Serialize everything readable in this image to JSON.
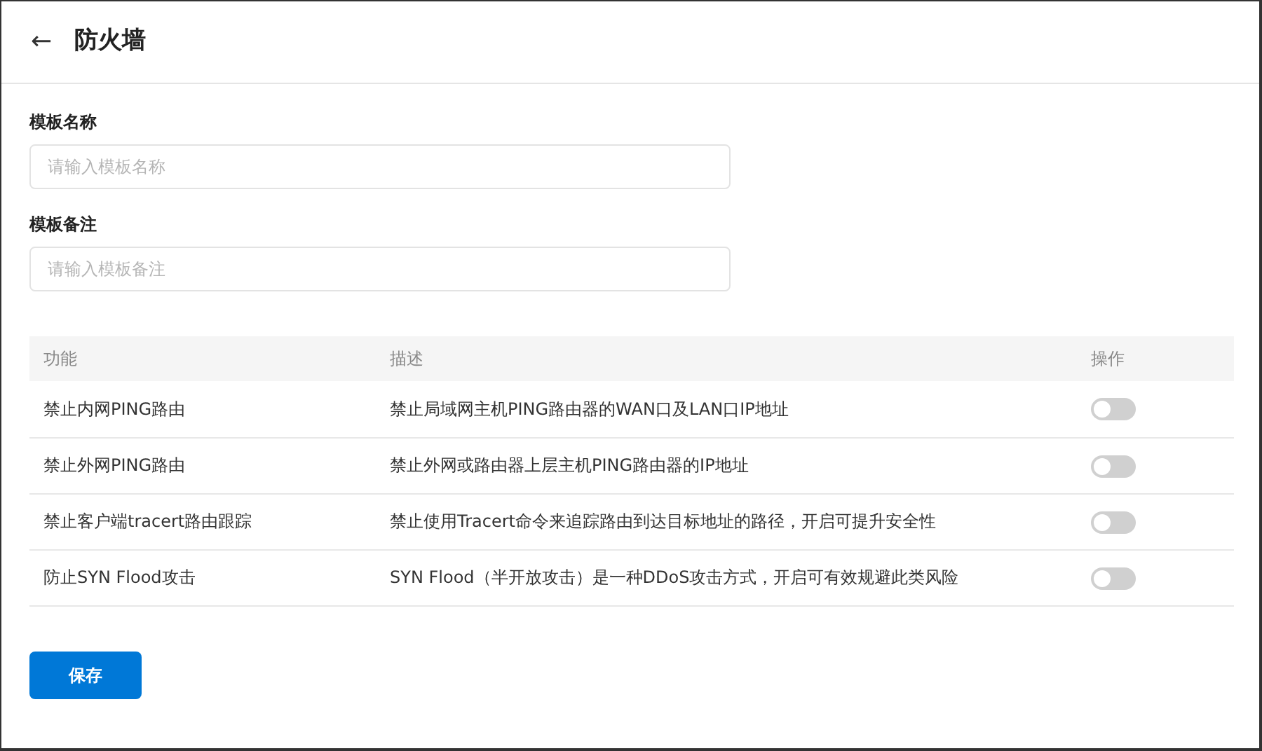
{
  "header": {
    "back": "←",
    "title": "防火墙"
  },
  "fields": [
    {
      "label": "模板名称",
      "placeholder": "请输入模板名称"
    },
    {
      "label": "模板备注",
      "placeholder": "请输入模板备注"
    }
  ],
  "table": {
    "columns": [
      "功能",
      "描述",
      "操作"
    ],
    "rows": [
      {
        "feature": "禁止内网PING路由",
        "description": "禁止局域网主机PING路由器的WAN口及LAN口IP地址",
        "on": false
      },
      {
        "feature": "禁止外网PING路由",
        "description": "禁止外网或路由器上层主机PING路由器的IP地址",
        "on": false
      },
      {
        "feature": "禁止客户端tracert路由跟踪",
        "description": "禁止使用Tracert命令来追踪路由到达目标地址的路径，开启可提升安全性",
        "on": false
      },
      {
        "feature": "防止SYN Flood攻击",
        "description": "SYN Flood（半开放攻击）是一种DDoS攻击方式，开启可有效规避此类风险",
        "on": false
      }
    ]
  },
  "save_button": "保存"
}
